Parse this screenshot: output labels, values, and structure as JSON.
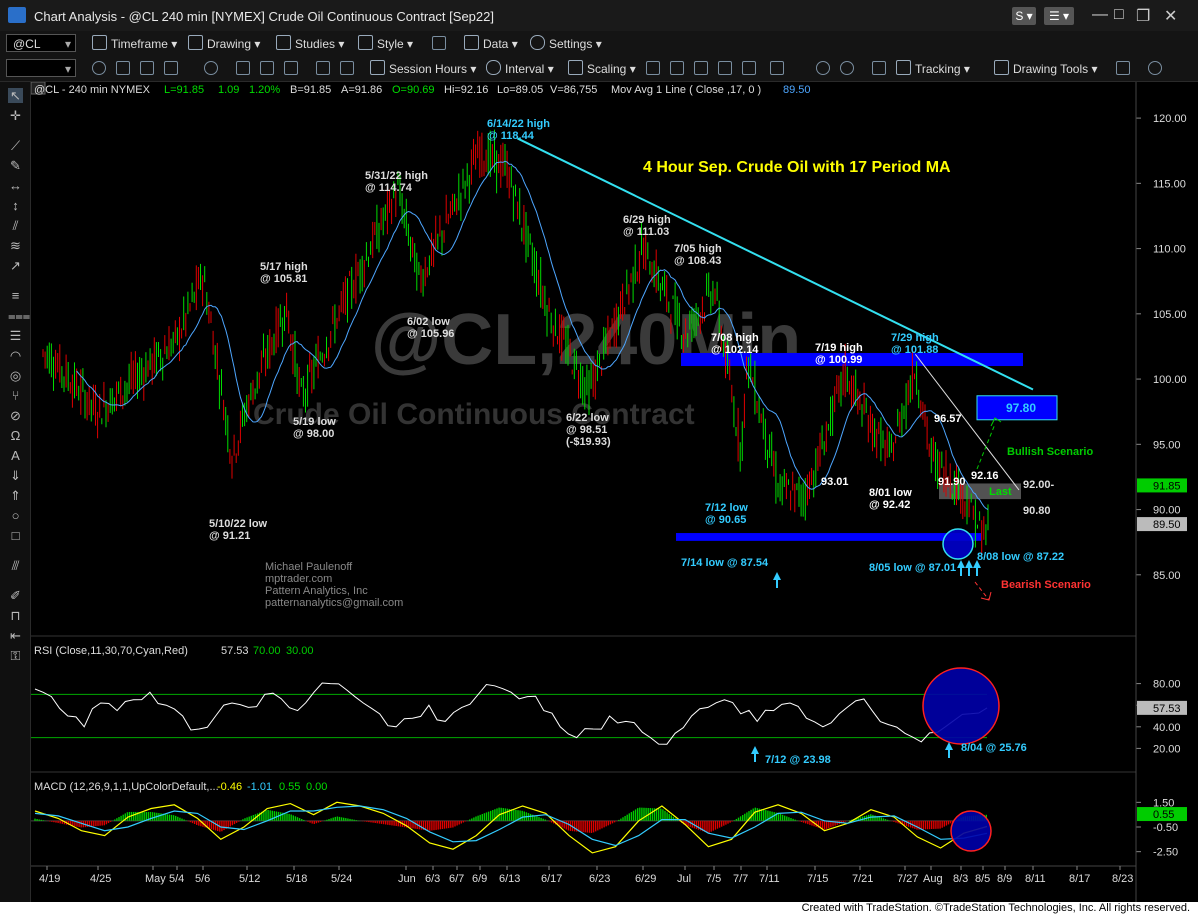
{
  "window": {
    "title": "Chart Analysis - @CL 240 min [NYMEX] Crude Oil Continuous Contract [Sep22]"
  },
  "toolbar1": {
    "symbol": "@CL",
    "timeframe": "Timeframe",
    "drawing": "Drawing",
    "studies": "Studies",
    "style": "Style",
    "data": "Data",
    "settings": "Settings"
  },
  "toolbar2": {
    "session_hours": "Session Hours",
    "interval": "Interval",
    "scaling": "Scaling",
    "tracking": "Tracking",
    "drawing_tools": "Drawing Tools"
  },
  "legend": {
    "sym": "@CL - 240 min  NYMEX",
    "last": "L=91.85",
    "chg": "1.09",
    "pct": "1.20%",
    "bid": "B=91.85",
    "ask": "A=91.86",
    "open": "O=90.69",
    "high": "Hi=92.16",
    "low": "Lo=89.05",
    "vol": "V=86,755",
    "ma": "Mov Avg 1 Line ( Close ,17,  0 )",
    "ma_value": "89.50"
  },
  "watermark": {
    "symbol": "@CL,240Min",
    "name": "Crude Oil Continuous Contract"
  },
  "author": [
    "Michael Paulenoff",
    "mptrader.com",
    "Pattern Analytics, Inc",
    "patternanalytics@gmail.com"
  ],
  "footer": "Created with TradeStation. ©TradeStation Technologies, Inc. All rights reserved.",
  "colors": {
    "up": "#00dd00",
    "down": "#e00000",
    "ma": "#4da6ff",
    "trendline": "#33e0f0",
    "annotation_cyan": "#33ccff",
    "title_yellow": "#ffff00"
  },
  "chart_data": [
    {
      "type": "line",
      "title": "4 Hour Sep. Crude Oil with 17 Period MA",
      "price_axis": {
        "ylim": [
          81.0,
          122.0
        ],
        "ticks": [
          "120.00",
          "115.00",
          "110.00",
          "105.00",
          "100.00",
          "95.00",
          "90.00",
          "85.00"
        ],
        "last_label": "91.85",
        "ma_label": "89.50"
      },
      "date_axis": [
        "4/19",
        "4/25",
        "May",
        "5/4",
        "5/6",
        "5/12",
        "5/18",
        "5/24",
        "Jun",
        "6/3",
        "6/7",
        "6/9",
        "6/13",
        "6/17",
        "6/23",
        "6/29",
        "Jul",
        "7/5",
        "7/7",
        "7/11",
        "7/15",
        "7/21",
        "7/27",
        "Aug",
        "8/3",
        "8/5",
        "8/9",
        "8/11",
        "8/17",
        "8/23"
      ],
      "series": [
        {
          "name": "@CL",
          "kind": "price"
        },
        {
          "name": "Mov Avg 1 Line",
          "kind": "ma"
        }
      ],
      "key_points": [
        {
          "date": "4/19",
          "close": 102.0
        },
        {
          "date": "4/25",
          "close": 97.5
        },
        {
          "date": "5/4",
          "close": 103.0
        },
        {
          "date": "5/6",
          "close": 108.0
        },
        {
          "date": "5/10",
          "close": 94.0
        },
        {
          "date": "5/12",
          "close": 98.0
        },
        {
          "date": "5/17",
          "close": 105.5
        },
        {
          "date": "5/19",
          "close": 98.5
        },
        {
          "date": "5/24",
          "close": 105.0
        },
        {
          "date": "5/31",
          "close": 114.5
        },
        {
          "date": "6/2",
          "close": 107.5
        },
        {
          "date": "6/9",
          "close": 117.5
        },
        {
          "date": "6/13",
          "close": 116.0
        },
        {
          "date": "6/17",
          "close": 105.0
        },
        {
          "date": "6/22",
          "close": 99.0
        },
        {
          "date": "6/29",
          "close": 110.0
        },
        {
          "date": "7/1",
          "close": 103.5
        },
        {
          "date": "7/5",
          "close": 107.0
        },
        {
          "date": "7/7",
          "close": 94.5
        },
        {
          "date": "7/8",
          "close": 101.5
        },
        {
          "date": "7/12",
          "close": 91.5
        },
        {
          "date": "7/14",
          "close": 91.0
        },
        {
          "date": "7/15",
          "close": 93.0
        },
        {
          "date": "7/19",
          "close": 100.5
        },
        {
          "date": "7/21",
          "close": 98.0
        },
        {
          "date": "7/25",
          "close": 94.0
        },
        {
          "date": "7/29",
          "close": 101.0
        },
        {
          "date": "8/1",
          "close": 94.0
        },
        {
          "date": "8/3",
          "close": 91.5
        },
        {
          "date": "8/5",
          "close": 88.0
        },
        {
          "date": "8/8",
          "close": 89.0
        },
        {
          "date": "8/9",
          "close": 91.85
        }
      ],
      "trendline": {
        "from": {
          "date": "6/14",
          "price": 118.44
        },
        "to": {
          "date": "8/11",
          "price": 99.2
        }
      },
      "zones": [
        {
          "label": "",
          "low": 101.0,
          "high": 102.0
        },
        {
          "label": "",
          "low": 87.6,
          "high": 88.2
        },
        {
          "label": "",
          "low": 90.8,
          "high": 92.0
        }
      ],
      "targets": [
        {
          "label": "97.80",
          "price": 97.8
        }
      ],
      "annotations": [
        {
          "text": [
            "6/14/22 high",
            "@ 118.44"
          ]
        },
        {
          "text": [
            "5/31/22 high",
            "@ 114.74"
          ]
        },
        {
          "text": [
            "5/17 high",
            "@ 105.81"
          ]
        },
        {
          "text": [
            "6/02 low",
            "@ 105.96"
          ]
        },
        {
          "text": [
            "5/19 low",
            "@ 98.00"
          ]
        },
        {
          "text": [
            "5/10/22 low",
            "@ 91.21"
          ]
        },
        {
          "text": [
            "6/29 high",
            "@ 111.03"
          ]
        },
        {
          "text": [
            "7/05 high",
            "@ 108.43"
          ]
        },
        {
          "text": [
            "6/22 low",
            "@ 98.51",
            "(-$19.93)"
          ]
        },
        {
          "text": [
            "7/08 high",
            "@ 102.14"
          ]
        },
        {
          "text": [
            "7/19 high",
            "@ 100.99"
          ]
        },
        {
          "text": [
            "7/29 high",
            "@ 101.88"
          ]
        },
        {
          "text": [
            "96.57"
          ]
        },
        {
          "text": [
            "93.01"
          ]
        },
        {
          "text": [
            "8/01 low",
            "@ 92.42"
          ]
        },
        {
          "text": [
            "91.90"
          ]
        },
        {
          "text": [
            "92.16"
          ]
        },
        {
          "text": [
            "Last"
          ]
        },
        {
          "text": [
            "92.00-"
          ]
        },
        {
          "text": [
            "90.80"
          ]
        },
        {
          "text": [
            "7/12 low",
            "@ 90.65"
          ]
        },
        {
          "text": [
            "7/14 low @ 87.54"
          ]
        },
        {
          "text": [
            "8/05 low @ 87.01"
          ]
        },
        {
          "text": [
            "8/08 low @ 87.22"
          ]
        },
        {
          "text": [
            "Bullish Scenario"
          ]
        },
        {
          "text": [
            "Bearish Scenario"
          ]
        }
      ]
    },
    {
      "type": "line",
      "title": "RSI (Close,11,30,70,Cyan,Red)",
      "legend_values": [
        "57.53",
        "70.00",
        "30.00"
      ],
      "ylim": [
        0,
        100
      ],
      "ticks": [
        "80.00",
        "60.00",
        "40.00",
        "20.00"
      ],
      "last_label": "57.53",
      "levels": [
        70,
        30
      ],
      "series": [
        {
          "name": "RSI",
          "values": [
            75,
            68,
            50,
            40,
            62,
            55,
            65,
            72,
            60,
            50,
            38,
            50,
            62,
            58,
            70,
            66,
            55,
            72,
            80,
            74,
            62,
            52,
            40,
            48,
            60,
            45,
            58,
            70,
            78,
            72,
            68,
            55,
            40,
            30,
            38,
            50,
            45,
            35,
            24,
            34,
            50,
            58,
            65,
            52,
            45,
            55,
            62,
            48,
            40,
            52,
            64,
            55,
            42,
            34,
            26,
            35,
            46,
            52,
            57.53
          ]
        }
      ],
      "annotations": [
        {
          "text": [
            "7/12 @ 23.98"
          ]
        },
        {
          "text": [
            "8/04 @ 25.76"
          ]
        }
      ]
    },
    {
      "type": "bar",
      "title": "MACD (12,26,9,1,1,UpColorDefault,...",
      "legend_values": [
        "-0.46",
        "-1.01",
        "0.55",
        "0.00"
      ],
      "ylim": [
        -3.5,
        2.5
      ],
      "ticks": [
        "1.50",
        "-0.50",
        "-2.50"
      ],
      "last_label": "0.55",
      "series": [
        {
          "name": "MACD",
          "values": [
            0.8,
            0.2,
            -0.8,
            -1.2,
            0.3,
            1.0,
            1.3,
            0.2,
            -1.5,
            -0.5,
            1.0,
            1.4,
            0.5,
            1.5,
            1.2,
            0.6,
            -0.4,
            -1.8,
            -2.3,
            -1.2,
            0.5,
            1.2,
            0.6,
            -1.2,
            -2.6,
            -2.1,
            0.0,
            1.2,
            -0.3,
            -2.1,
            -1.5,
            0.7,
            1.3,
            0.6,
            -0.8,
            -0.2,
            0.9,
            0.3,
            -1.3,
            -2.2,
            -1.0,
            -0.46
          ]
        },
        {
          "name": "Signal",
          "values": [
            0.6,
            0.4,
            -0.2,
            -0.8,
            -0.5,
            0.2,
            0.8,
            0.6,
            -0.5,
            -0.7,
            0.0,
            0.8,
            0.8,
            1.1,
            1.2,
            0.9,
            0.2,
            -0.9,
            -1.7,
            -1.6,
            -0.7,
            0.3,
            0.5,
            -0.3,
            -1.5,
            -2.0,
            -1.2,
            0.1,
            0.1,
            -1.0,
            -1.4,
            -0.5,
            0.6,
            0.7,
            0.0,
            -0.2,
            0.3,
            0.4,
            -0.5,
            -1.5,
            -1.4,
            -1.01
          ]
        }
      ]
    }
  ]
}
